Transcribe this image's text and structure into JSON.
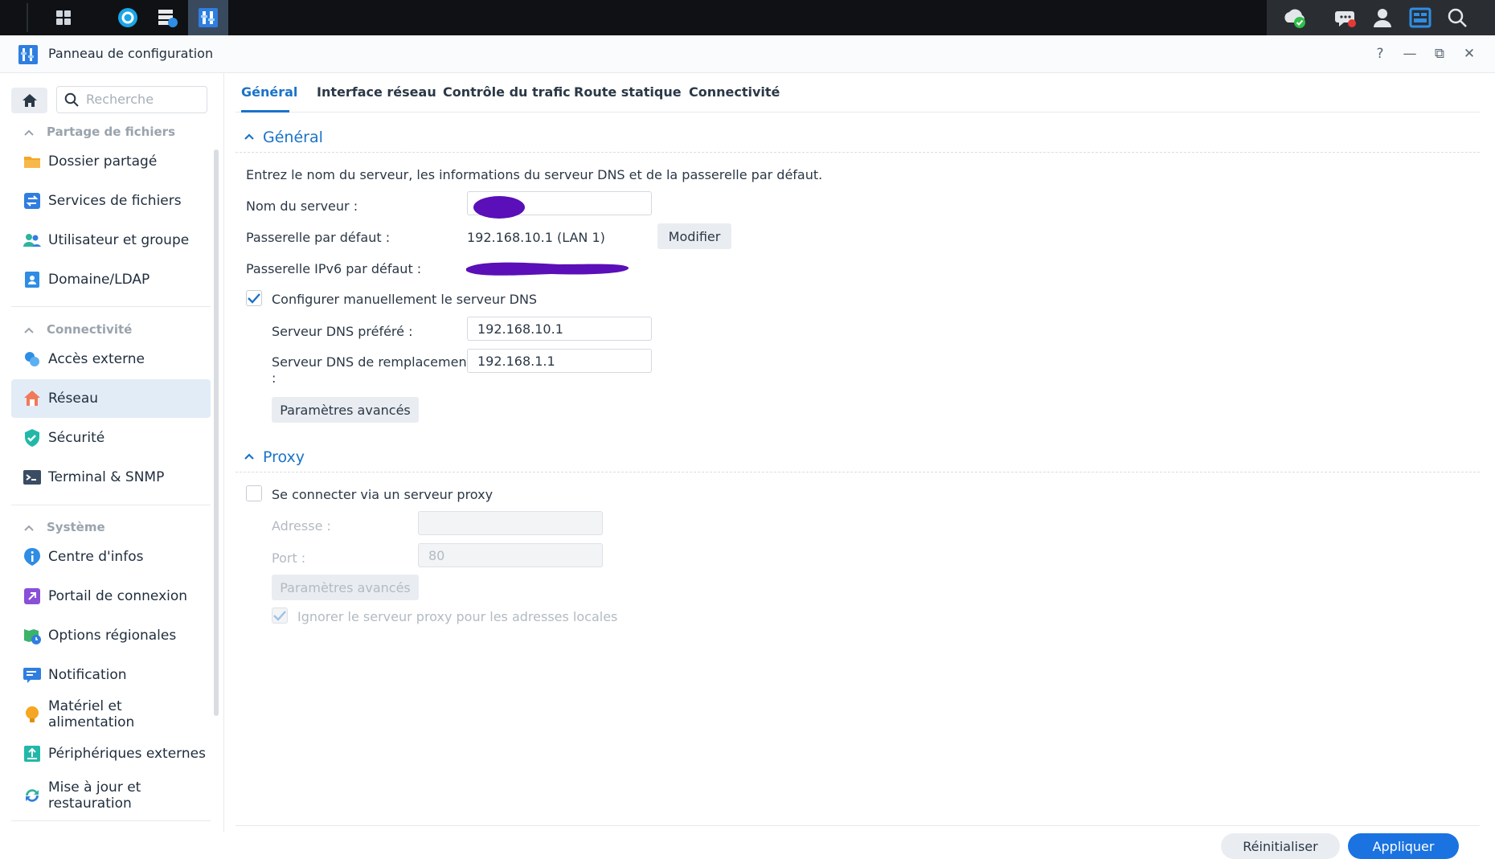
{
  "colors": {
    "accent": "#1a73c8",
    "apply": "#1a73e0",
    "redaction": "#5a0fb8",
    "taskbar": "#0f1114"
  },
  "taskbar": {
    "left_icons": [
      "grid-menu-icon",
      "synology-drive-icon",
      "storage-manager-icon",
      "control-panel-icon"
    ],
    "right_icons": [
      "cloud-sync-icon",
      "chat-icon",
      "user-icon",
      "widgets-icon",
      "search-icon"
    ]
  },
  "window": {
    "title": "Panneau de configuration",
    "controls": [
      "?",
      "—",
      "⧉",
      "✕"
    ]
  },
  "sidebar": {
    "search_placeholder": "Recherche",
    "sections": [
      {
        "label": "Partage de fichiers",
        "items": [
          {
            "label": "Dossier partagé",
            "icon": "folder-icon"
          },
          {
            "label": "Services de fichiers",
            "icon": "file-services-icon"
          },
          {
            "label": "Utilisateur et groupe",
            "icon": "users-icon"
          },
          {
            "label": "Domaine/LDAP",
            "icon": "domain-icon"
          }
        ]
      },
      {
        "label": "Connectivité",
        "items": [
          {
            "label": "Accès externe",
            "icon": "external-access-icon"
          },
          {
            "label": "Réseau",
            "icon": "network-icon",
            "active": true
          },
          {
            "label": "Sécurité",
            "icon": "security-shield-icon"
          },
          {
            "label": "Terminal & SNMP",
            "icon": "terminal-icon"
          }
        ]
      },
      {
        "label": "Système",
        "items": [
          {
            "label": "Centre d'infos",
            "icon": "info-icon"
          },
          {
            "label": "Portail de connexion",
            "icon": "login-portal-icon"
          },
          {
            "label": "Options régionales",
            "icon": "regional-options-icon"
          },
          {
            "label": "Notification",
            "icon": "notification-icon"
          },
          {
            "label": "Matériel et alimentation",
            "icon": "hardware-power-icon"
          },
          {
            "label": "Périphériques externes",
            "icon": "external-devices-icon"
          },
          {
            "label": "Mise à jour et restauration",
            "icon": "update-restore-icon"
          }
        ]
      }
    ]
  },
  "tabs": [
    "Général",
    "Interface réseau",
    "Contrôle du trafic",
    "Route statique",
    "Connectivité"
  ],
  "general": {
    "title": "Général",
    "description": "Entrez le nom du serveur, les informations du serveur DNS et de la passerelle par défaut.",
    "server_name_label": "Nom du serveur :",
    "gateway_label": "Passerelle par défaut :",
    "gateway_value": "192.168.10.1 (LAN 1)",
    "modify_label": "Modifier",
    "ipv6_gateway_label": "Passerelle IPv6 par défaut :",
    "manual_dns_label": "Configurer manuellement le serveur DNS",
    "manual_dns_checked": true,
    "preferred_dns_label": "Serveur DNS préféré :",
    "preferred_dns_value": "192.168.10.1",
    "alternate_dns_label_line1": "Serveur DNS de remplacement",
    "alternate_dns_label_line2": ":",
    "alternate_dns_value": "192.168.1.1",
    "advanced_label": "Paramètres avancés"
  },
  "proxy": {
    "title": "Proxy",
    "connect_label": "Se connecter via un serveur proxy",
    "connect_checked": false,
    "address_label": "Adresse :",
    "address_value": "",
    "port_label": "Port :",
    "port_value": "80",
    "advanced_label": "Paramètres avancés",
    "bypass_label": "Ignorer le serveur proxy pour les adresses locales",
    "bypass_checked": true
  },
  "footer": {
    "reset_label": "Réinitialiser",
    "apply_label": "Appliquer"
  }
}
